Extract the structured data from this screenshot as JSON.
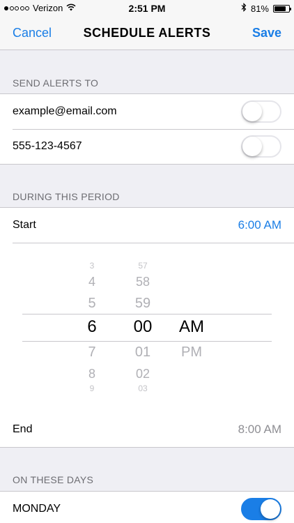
{
  "status_bar": {
    "carrier": "Verizon",
    "time": "2:51 PM",
    "battery_percent": "81%",
    "battery_level": 0.81,
    "signal_bars": 1,
    "signal_total": 5,
    "icons": [
      "wifi-icon",
      "bluetooth-icon",
      "battery-icon"
    ]
  },
  "nav": {
    "cancel_label": "Cancel",
    "title": "SCHEDULE ALERTS",
    "save_label": "Save"
  },
  "send_alerts": {
    "header": "SEND ALERTS TO",
    "items": [
      {
        "label": "example@email.com",
        "enabled": false
      },
      {
        "label": "555-123-4567",
        "enabled": false
      }
    ]
  },
  "period": {
    "header": "DURING THIS PERIOD",
    "start_label": "Start",
    "start_value": "6:00 AM",
    "end_label": "End",
    "end_value": "8:00 AM",
    "picker": {
      "hours": [
        "3",
        "4",
        "5",
        "6",
        "7",
        "8",
        "9"
      ],
      "minutes": [
        "57",
        "58",
        "59",
        "00",
        "01",
        "02",
        "03"
      ],
      "ampm": [
        "AM",
        "PM"
      ],
      "selected_hour": "6",
      "selected_minute": "00",
      "selected_ampm": "AM"
    }
  },
  "days": {
    "header": "ON THESE DAYS",
    "items": [
      {
        "label": "MONDAY",
        "enabled": true
      }
    ]
  },
  "colors": {
    "accent": "#1a7ee6",
    "background": "#efeff4",
    "separator": "#c8c7cc",
    "secondary_text": "#6d6d72"
  }
}
